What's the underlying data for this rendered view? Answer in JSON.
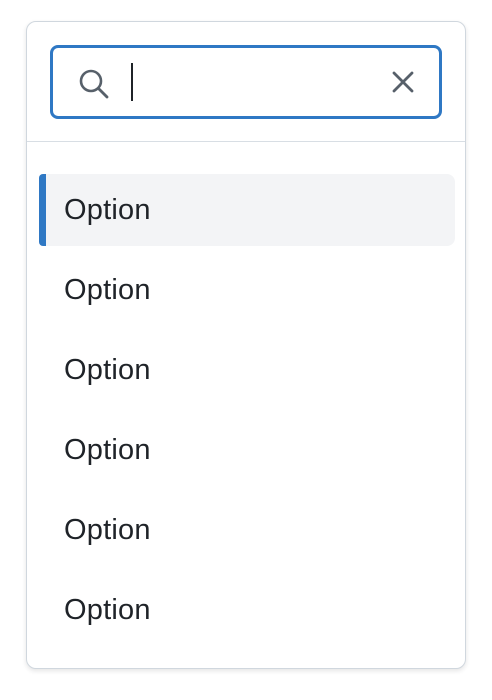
{
  "search": {
    "value": "",
    "placeholder": ""
  },
  "icons": {
    "search": "search-icon",
    "clear": "close-icon"
  },
  "colors": {
    "focus_border": "#2f78c4",
    "active_indicator": "#2f78c4",
    "active_background": "#f3f4f6",
    "text": "#1f2328",
    "icon": "#57606a"
  },
  "options": [
    {
      "label": "Option",
      "active": true
    },
    {
      "label": "Option",
      "active": false
    },
    {
      "label": "Option",
      "active": false
    },
    {
      "label": "Option",
      "active": false
    },
    {
      "label": "Option",
      "active": false
    },
    {
      "label": "Option",
      "active": false
    }
  ]
}
